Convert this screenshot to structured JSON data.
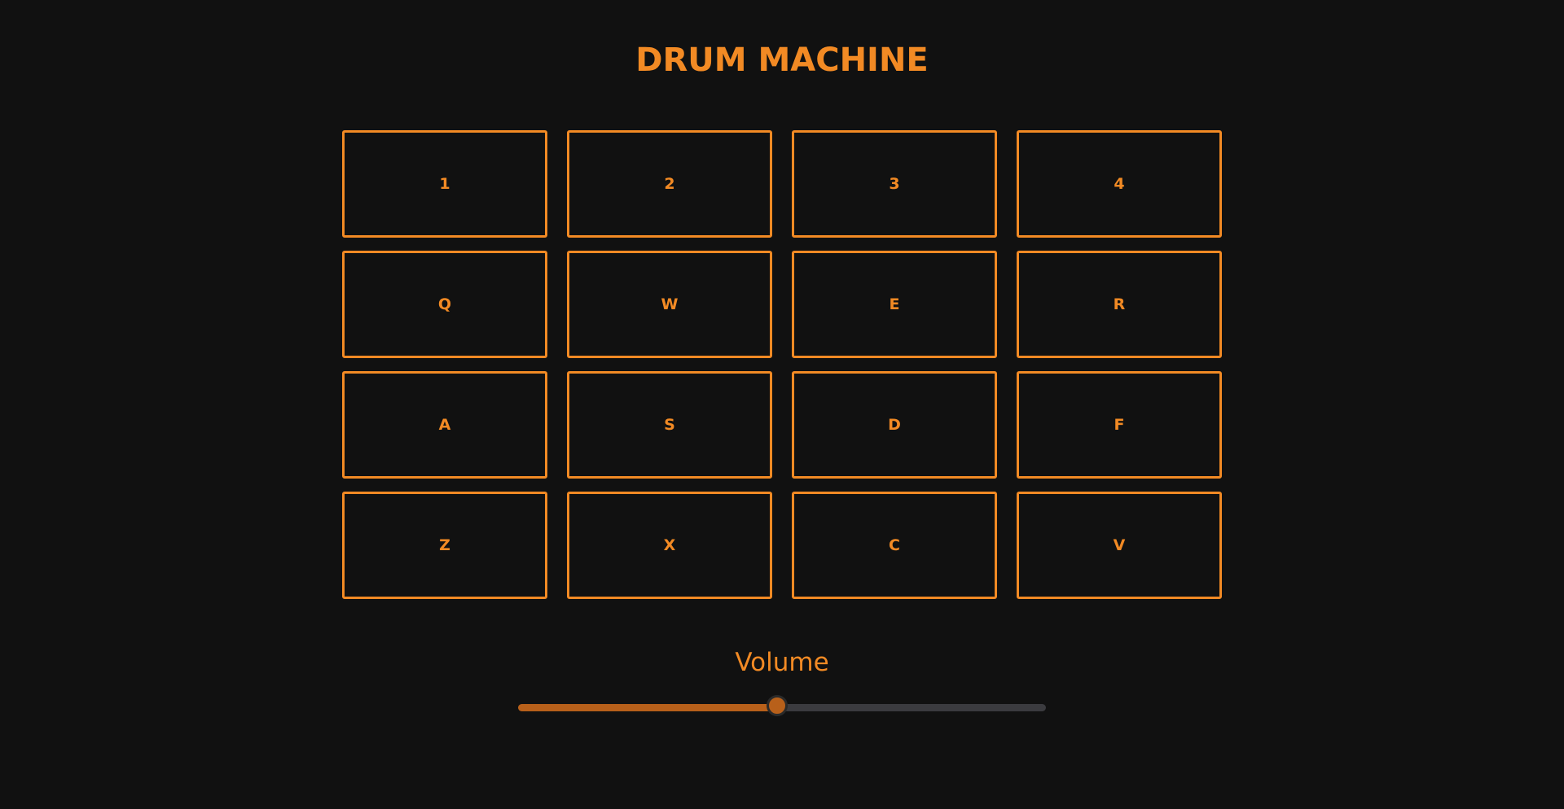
{
  "app": {
    "title": "DRUM MACHINE"
  },
  "pads": [
    {
      "key": "1"
    },
    {
      "key": "2"
    },
    {
      "key": "3"
    },
    {
      "key": "4"
    },
    {
      "key": "Q"
    },
    {
      "key": "W"
    },
    {
      "key": "E"
    },
    {
      "key": "R"
    },
    {
      "key": "A"
    },
    {
      "key": "S"
    },
    {
      "key": "D"
    },
    {
      "key": "F"
    },
    {
      "key": "Z"
    },
    {
      "key": "X"
    },
    {
      "key": "C"
    },
    {
      "key": "V"
    }
  ],
  "volume": {
    "label": "Volume",
    "value": 0.49
  },
  "colors": {
    "background": "#111111",
    "accent": "#f28a24",
    "slider_fill": "#b8601a",
    "slider_track": "#3b3b3f",
    "thumb": "#b8601a"
  }
}
